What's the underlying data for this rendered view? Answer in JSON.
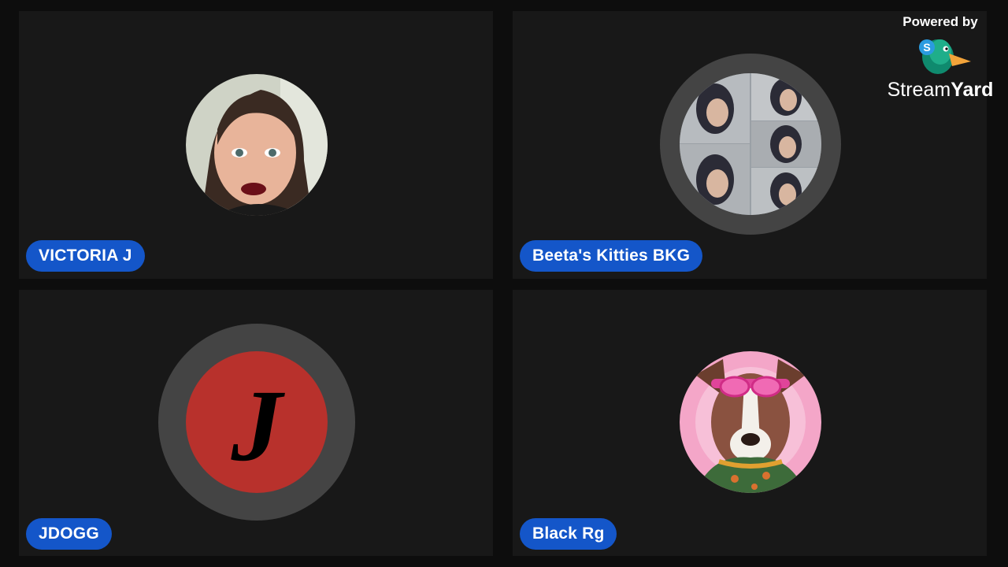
{
  "participants": [
    {
      "name": "VICTORIA J",
      "avatar": "photo-woman-icon"
    },
    {
      "name": "Beeta's Kitties BKG",
      "avatar": "photo-collage-icon"
    },
    {
      "name": "JDOGG",
      "avatar": "letter-j-logo-icon",
      "initial": "J"
    },
    {
      "name": "Black Rg",
      "avatar": "dog-goggles-icon"
    }
  ],
  "branding": {
    "powered_by": "Powered by",
    "name_light": "Stream",
    "name_bold": "Yard",
    "logo_letter": "S"
  },
  "colors": {
    "pill": "#1456c9",
    "tile": "#181818",
    "ring": "#444444",
    "jdogg_red": "#b8312c"
  }
}
